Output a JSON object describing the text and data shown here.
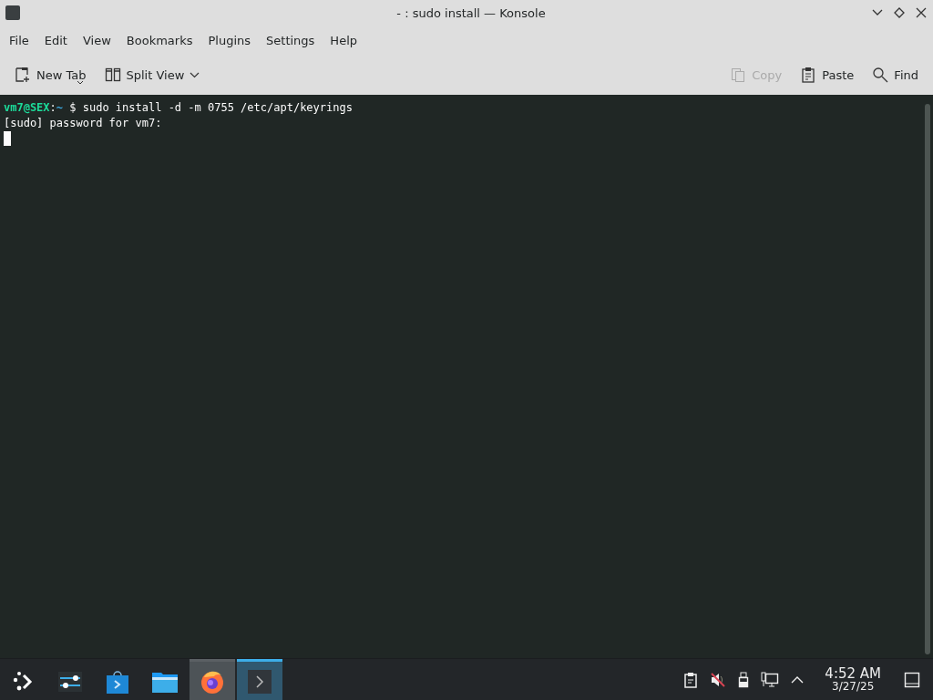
{
  "window": {
    "title": "- : sudo install — Konsole"
  },
  "menu": [
    "File",
    "Edit",
    "View",
    "Bookmarks",
    "Plugins",
    "Settings",
    "Help"
  ],
  "toolbar": {
    "left": [
      {
        "kind": "newtab",
        "label": "New Tab",
        "disabled": false
      },
      {
        "kind": "split",
        "label": "Split View",
        "disabled": false
      }
    ],
    "right": [
      {
        "kind": "copy",
        "label": "Copy",
        "disabled": true
      },
      {
        "kind": "paste",
        "label": "Paste",
        "disabled": false
      },
      {
        "kind": "find",
        "label": "Find",
        "disabled": false
      }
    ]
  },
  "terminal": {
    "lines": [
      {
        "kind": "prompt",
        "user": "vm7@SEX",
        "sep": ":",
        "path": "~",
        "command": "$ sudo install -d -m 0755 /etc/apt/keyrings"
      },
      {
        "kind": "output",
        "text": "[sudo] password for vm7:"
      }
    ],
    "cursor": true
  },
  "taskbar": {
    "apps": [
      {
        "kind": "launcher",
        "selected": false,
        "highlighted": false
      },
      {
        "kind": "settings",
        "selected": false,
        "highlighted": false
      },
      {
        "kind": "store",
        "selected": false,
        "highlighted": false
      },
      {
        "kind": "files",
        "selected": false,
        "highlighted": false
      },
      {
        "kind": "browser",
        "selected": false,
        "highlighted": true
      },
      {
        "kind": "terminal",
        "selected": true,
        "highlighted": false
      }
    ],
    "tray": [
      {
        "kind": "clipboard"
      },
      {
        "kind": "volume"
      },
      {
        "kind": "usb"
      },
      {
        "kind": "network"
      },
      {
        "kind": "expand"
      }
    ],
    "time": "4:52 AM",
    "date": "3/27/25"
  }
}
